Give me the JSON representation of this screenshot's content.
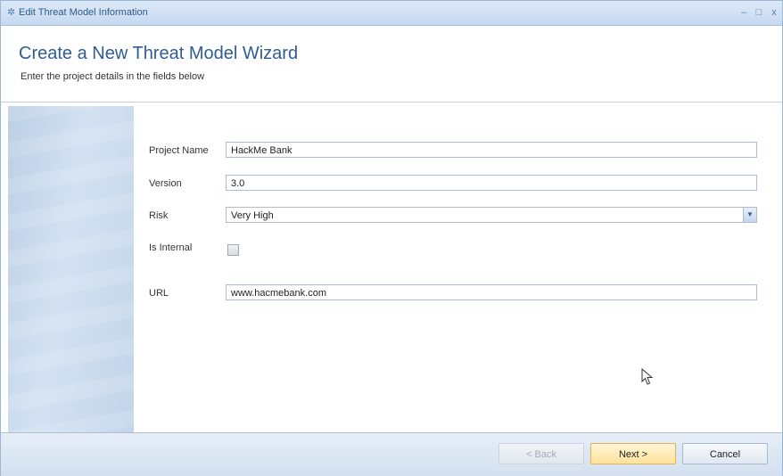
{
  "window": {
    "title": "Edit Threat Model Information",
    "icon": "gear-icon",
    "controls": {
      "minimize": "–",
      "maximize": "□",
      "close": "x"
    }
  },
  "wizard": {
    "title": "Create a New Threat Model Wizard",
    "subtitle": "Enter the project details in the fields below"
  },
  "form": {
    "project_name_label": "Project Name",
    "project_name_value": "HackMe Bank",
    "version_label": "Version",
    "version_value": "3.0",
    "risk_label": "Risk",
    "risk_value": "Very High",
    "is_internal_label": "Is Internal",
    "is_internal_checked": false,
    "url_label": "URL",
    "url_value": "www.hacmebank.com"
  },
  "buttons": {
    "back": "< Back",
    "next": "Next >",
    "cancel": "Cancel"
  },
  "colors": {
    "accent": "#2f5d94",
    "next_button": "#ffe29b",
    "side_panel": "#c3d5ea"
  }
}
